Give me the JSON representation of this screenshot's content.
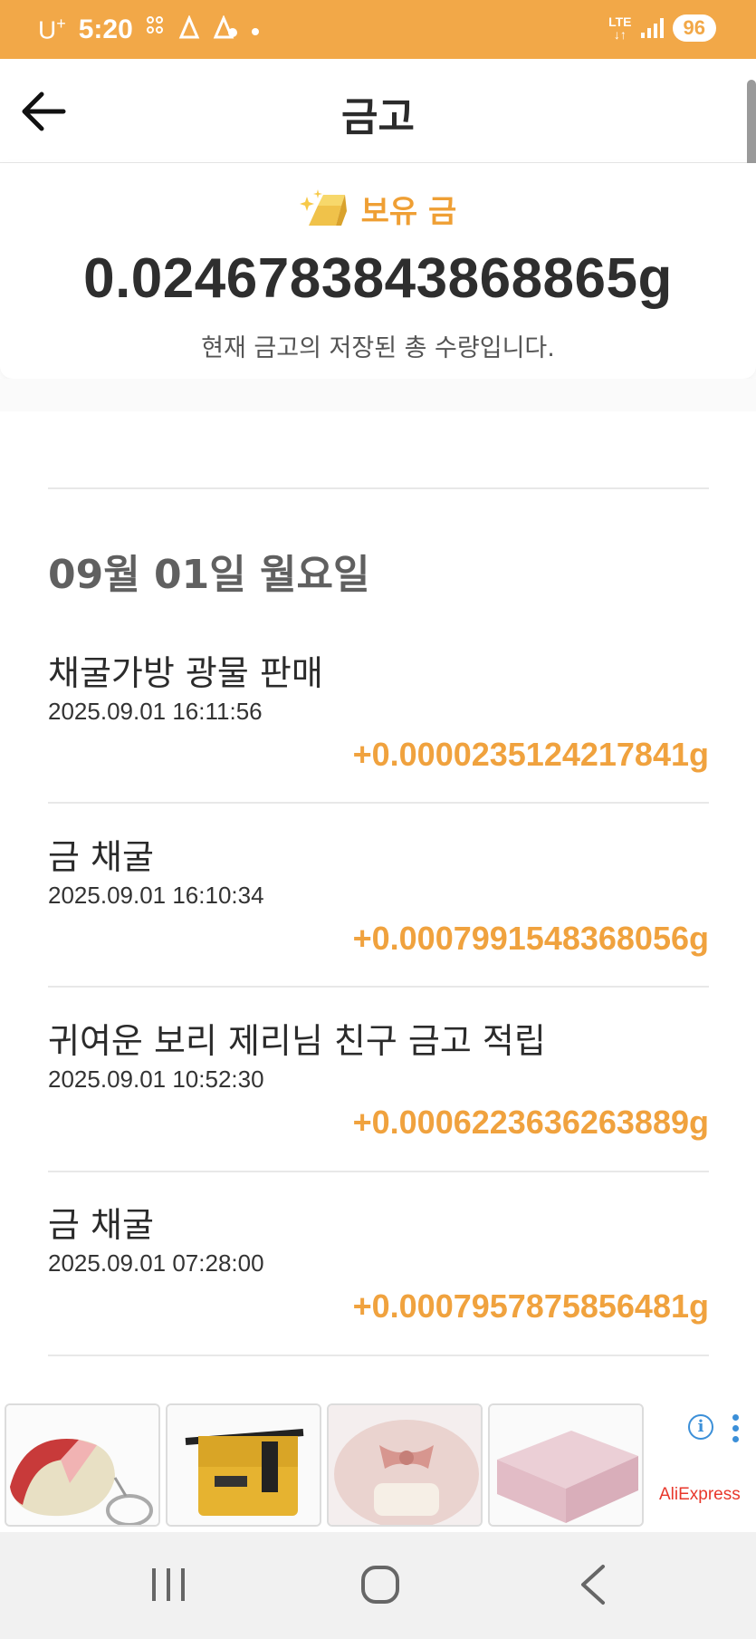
{
  "status_bar": {
    "carrier": "U",
    "carrier_sup": "+",
    "time": "5:20",
    "lte_top": "LTE",
    "lte_bottom": "↓↑",
    "battery": "96"
  },
  "header": {
    "title": "금고"
  },
  "balance": {
    "label": "보유 금",
    "value": "0.0246783843868865g",
    "description": "현재 금고의 저장된 총 수량입니다."
  },
  "history": {
    "date_header": "09월 01일 월요일",
    "items": [
      {
        "title": "채굴가방 광물 판매",
        "time": "2025.09.01 16:11:56",
        "amount": "+0.0000235124217841g"
      },
      {
        "title": "금 채굴",
        "time": "2025.09.01 16:10:34",
        "amount": "+0.0007991548368056g"
      },
      {
        "title": "귀여운 보리 제리님 친구 금고 적립",
        "time": "2025.09.01 10:52:30",
        "amount": "+0.0006223636263889g"
      },
      {
        "title": "금 채굴",
        "time": "2025.09.01 07:28:00",
        "amount": "+0.0007957875856481g"
      }
    ]
  },
  "ad": {
    "brand": "AliExpress",
    "info_glyph": "i"
  },
  "colors": {
    "accent": "#f2a848",
    "amount": "#f0a23e",
    "nav_bg": "#f1f1f1"
  }
}
